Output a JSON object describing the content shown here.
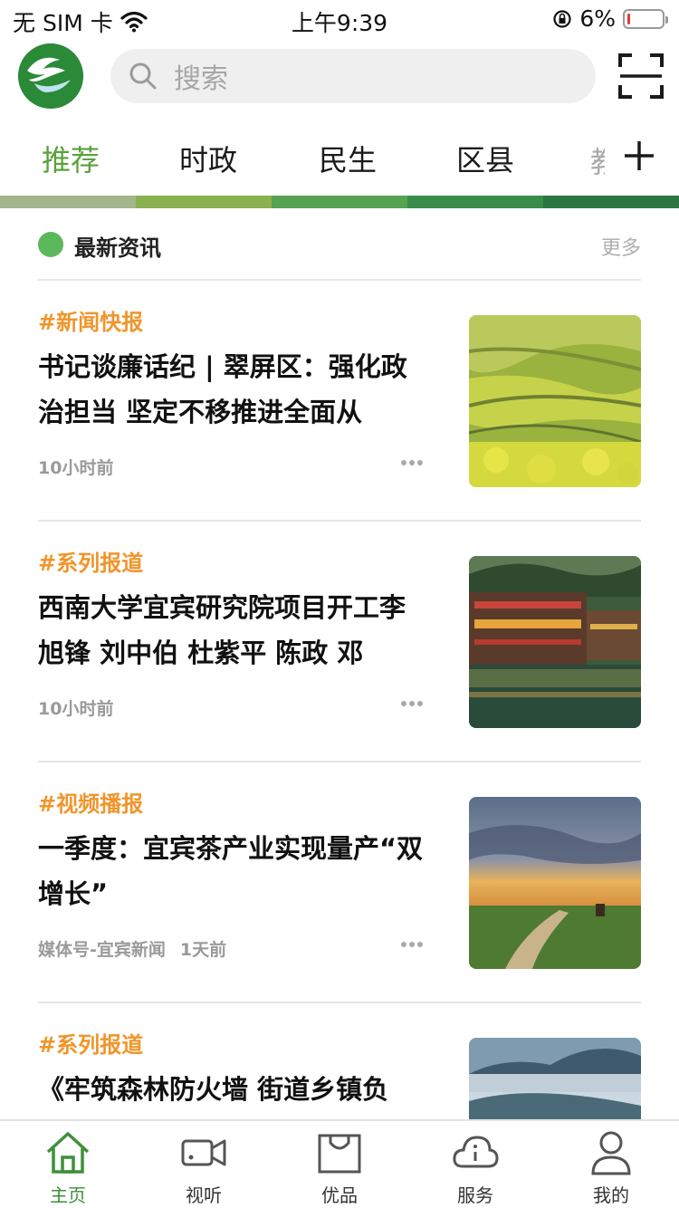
{
  "status_bar": {
    "carrier": "无 SIM 卡",
    "time": "上午9:39",
    "battery_pct": "6%",
    "battery_level": 0.06
  },
  "header": {
    "logo_icon": "app-logo",
    "search_placeholder": "搜索",
    "scan_icon": "scan-icon"
  },
  "tabs": {
    "items": [
      {
        "label": "推荐",
        "active": true
      },
      {
        "label": "时政",
        "active": false
      },
      {
        "label": "民生",
        "active": false
      },
      {
        "label": "区县",
        "active": false
      }
    ],
    "overflow_glyph": "教",
    "add_icon": "plus-icon"
  },
  "strip_colors": [
    "#a3b58a",
    "#8ab04f",
    "#56a351",
    "#3a8c4a",
    "#2a7540"
  ],
  "section": {
    "title": "最新资讯",
    "more": "更多",
    "dot_color": "#5cb85c"
  },
  "news": [
    {
      "tag": "#新闻快报",
      "title": "书记谈廉话纪 | 翠屏区：强化政治担当 坚定不移推进全面从",
      "source": "",
      "time": "10小时前",
      "image": "rapeseed-field"
    },
    {
      "tag": "#系列报道",
      "title": "西南大学宜宾研究院项目开工李旭锋 刘中伯 杜紫平 陈政 邓",
      "source": "",
      "time": "10小时前",
      "image": "riverside-town"
    },
    {
      "tag": "#视频播报",
      "title": "一季度：宜宾茶产业实现量产“双增长”",
      "source": "媒体号-宜宾新闻",
      "time": "1天前",
      "image": "grassland-sunset"
    },
    {
      "tag": "#系列报道",
      "title": "《牢筑森林防火墙 街道乡镇负",
      "source": "",
      "time": "",
      "image": "misty-mountains"
    }
  ],
  "bottom_nav": [
    {
      "label": "主页",
      "icon": "home-icon",
      "active": true
    },
    {
      "label": "视听",
      "icon": "video-camera-icon",
      "active": false
    },
    {
      "label": "优品",
      "icon": "shopping-bag-icon",
      "active": false
    },
    {
      "label": "服务",
      "icon": "cloud-info-icon",
      "active": false
    },
    {
      "label": "我的",
      "icon": "user-icon",
      "active": false
    }
  ],
  "colors": {
    "accent": "#5aa13b",
    "tag": "#f0952b",
    "nav_active": "#3f8f3a"
  }
}
